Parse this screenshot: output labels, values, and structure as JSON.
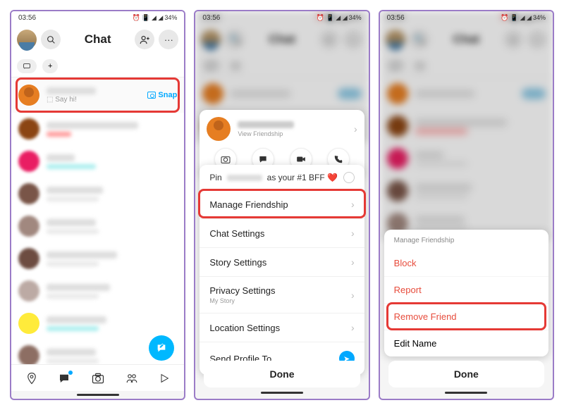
{
  "statusbar": {
    "time": "03:56",
    "battery": "34%",
    "icons": "⏰ 📳 ◢ ◢"
  },
  "header": {
    "title": "Chat"
  },
  "firstChat": {
    "sayHi": "⬚ Say hi!",
    "snap": "Snap"
  },
  "panel2": {
    "viewFriendship": "View Friendship",
    "pinPrefix": "Pin",
    "pinSuffix": "as your #1 BFF ❤️",
    "menu": {
      "manage": "Manage Friendship",
      "chat": "Chat Settings",
      "story": "Story Settings",
      "privacy": "Privacy Settings",
      "privacySub": "My Story",
      "location": "Location Settings",
      "send": "Send Profile To…"
    },
    "done": "Done"
  },
  "panel3": {
    "title": "Manage Friendship",
    "block": "Block",
    "report": "Report",
    "remove": "Remove Friend",
    "edit": "Edit Name",
    "done": "Done"
  }
}
